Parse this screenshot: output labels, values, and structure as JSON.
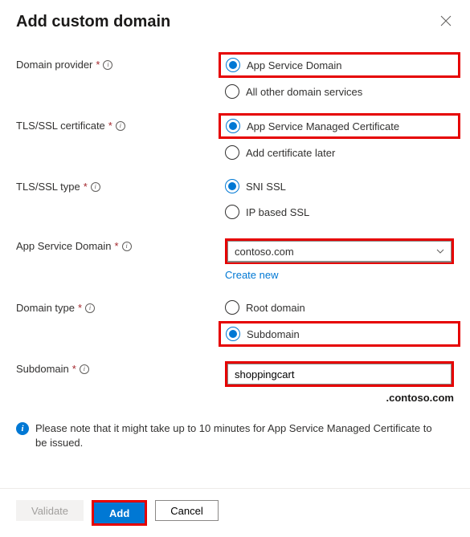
{
  "header": {
    "title": "Add custom domain"
  },
  "fields": {
    "domainProvider": {
      "label": "Domain provider",
      "options": {
        "appService": "App Service Domain",
        "other": "All other domain services"
      }
    },
    "tlsCert": {
      "label": "TLS/SSL certificate",
      "options": {
        "managed": "App Service Managed Certificate",
        "later": "Add certificate later"
      }
    },
    "tlsType": {
      "label": "TLS/SSL type",
      "options": {
        "sni": "SNI SSL",
        "ip": "IP based SSL"
      }
    },
    "appServiceDomain": {
      "label": "App Service Domain",
      "value": "contoso.com",
      "createNew": "Create new"
    },
    "domainType": {
      "label": "Domain type",
      "options": {
        "root": "Root domain",
        "sub": "Subdomain"
      }
    },
    "subdomain": {
      "label": "Subdomain",
      "value": "shoppingcart",
      "suffix": ".contoso.com"
    }
  },
  "note": "Please note that it might take up to 10 minutes for App Service Managed Certificate to be issued.",
  "footer": {
    "validate": "Validate",
    "add": "Add",
    "cancel": "Cancel"
  }
}
